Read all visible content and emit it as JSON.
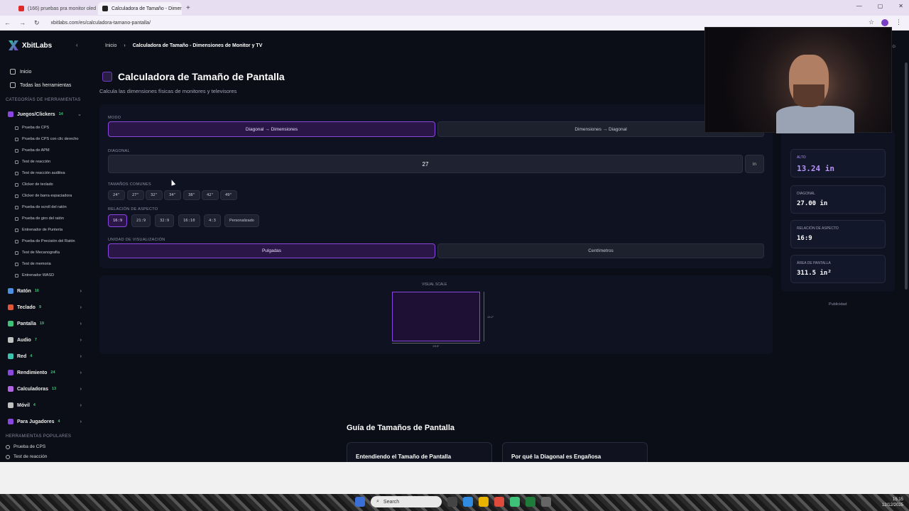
{
  "browser": {
    "tabs": [
      {
        "label": "(166) pruebas pra monitor oled",
        "favicon_color": "#e02a2a",
        "active": false
      },
      {
        "label": "Calculadora de Tamaño - Dimer",
        "favicon_color": "#222222",
        "active": true
      }
    ],
    "new_tab": "+",
    "url": "xbitlabs.com/es/calculadora-tamano-pantalla/"
  },
  "sidebar": {
    "logo": "XbitLabs",
    "top_items": [
      {
        "label": "Inicio",
        "icon": "home-icon"
      },
      {
        "label": "Todas las herramientas",
        "icon": "grid-icon"
      }
    ],
    "categories_label": "CATEGORÍAS DE HERRAMIENTAS",
    "open_category": {
      "label": "Juegos/Clickers",
      "count": "14",
      "icon_color": "#8a47e0"
    },
    "sub_items": [
      "Prueba de CPS",
      "Prueba de CPS con clic derecho",
      "Prueba de APM",
      "Test de reacción",
      "Test de reacción auditiva",
      "Clicker de teclado",
      "Clicker de barra espaciadora",
      "Prueba de scroll del ratón",
      "Prueba de giro del ratón",
      "Entrenador de Puntería",
      "Prueba de Precisión del Ratón",
      "Test de Mecanografía",
      "Test de memoria",
      "Entrenador WASD"
    ],
    "categories": [
      {
        "label": "Ratón",
        "count": "16",
        "icon_color": "#4a8fe0"
      },
      {
        "label": "Teclado",
        "count": "9",
        "icon_color": "#e0563a"
      },
      {
        "label": "Pantalla",
        "count": "19",
        "icon_color": "#3ec27a"
      },
      {
        "label": "Audio",
        "count": "7",
        "icon_color": "#c0c0c0"
      },
      {
        "label": "Red",
        "count": "4",
        "icon_color": "#3ec2b0"
      },
      {
        "label": "Rendimiento",
        "count": "24",
        "icon_color": "#8a47e0"
      },
      {
        "label": "Calculadoras",
        "count": "13",
        "icon_color": "#b066e0"
      },
      {
        "label": "Móvil",
        "count": "4",
        "icon_color": "#c0c0c0"
      },
      {
        "label": "Para Jugadores",
        "count": "4",
        "icon_color": "#8a47e0"
      }
    ],
    "popular_label": "HERRAMIENTAS POPULARES",
    "popular": [
      "Prueba de CPS",
      "Test de reacción"
    ]
  },
  "breadcrumb": {
    "home": "Inicio",
    "sep": "›",
    "current": "Calculadora de Tamaño - Dimensiones de Monitor y TV"
  },
  "page": {
    "title": "Calculadora de Tamaño de Pantalla",
    "subtitle": "Calcula las dimensiones físicas de monitores y televisores"
  },
  "form": {
    "mode_label": "MODO",
    "mode_options": [
      "Diagonal → Dimensiones",
      "Dimensiones → Diagonal"
    ],
    "diagonal_label": "DIAGONAL",
    "diagonal_value": "27",
    "diagonal_unit": "in",
    "common_label": "TAMAÑOS COMUNES",
    "common_sizes": [
      "24\"",
      "27\"",
      "32\"",
      "34\"",
      "38\"",
      "42\"",
      "49\""
    ],
    "aspect_label": "RELACIÓN DE ASPECTO",
    "aspect_options": [
      "16:9",
      "21:9",
      "32:9",
      "16:10",
      "4:3",
      "Personalizado"
    ],
    "unit_label": "UNIDAD DE VISUALIZACIÓN",
    "unit_options": [
      "Pulgadas",
      "Centímetros"
    ]
  },
  "visual": {
    "label": "VISUAL SCALE",
    "width_label": "23.5\"",
    "height_label": "13.2\""
  },
  "results": [
    {
      "label": "ALTO",
      "value": "13.24 in",
      "accent": true
    },
    {
      "label": "DIAGONAL",
      "value": "27.00 in",
      "accent": false
    },
    {
      "label": "RELACIÓN DE ASPECTO",
      "value": "16:9",
      "accent": false
    },
    {
      "label": "ÁREA DE PANTALLA",
      "value": "311.5 in²",
      "accent": false
    }
  ],
  "ad_label": "Publicidad",
  "guide": {
    "title": "Guía de Tamaños de Pantalla",
    "cards": [
      "Entendiendo el Tamaño de Pantalla",
      "Por qué la Diagonal es Engañosa"
    ]
  },
  "taskbar": {
    "search": "Search",
    "time": "15:15",
    "date": "12/12/2025"
  },
  "colors": {
    "accent": "#8a47e0",
    "background": "#0b0d17",
    "panel": "#0f1220"
  }
}
